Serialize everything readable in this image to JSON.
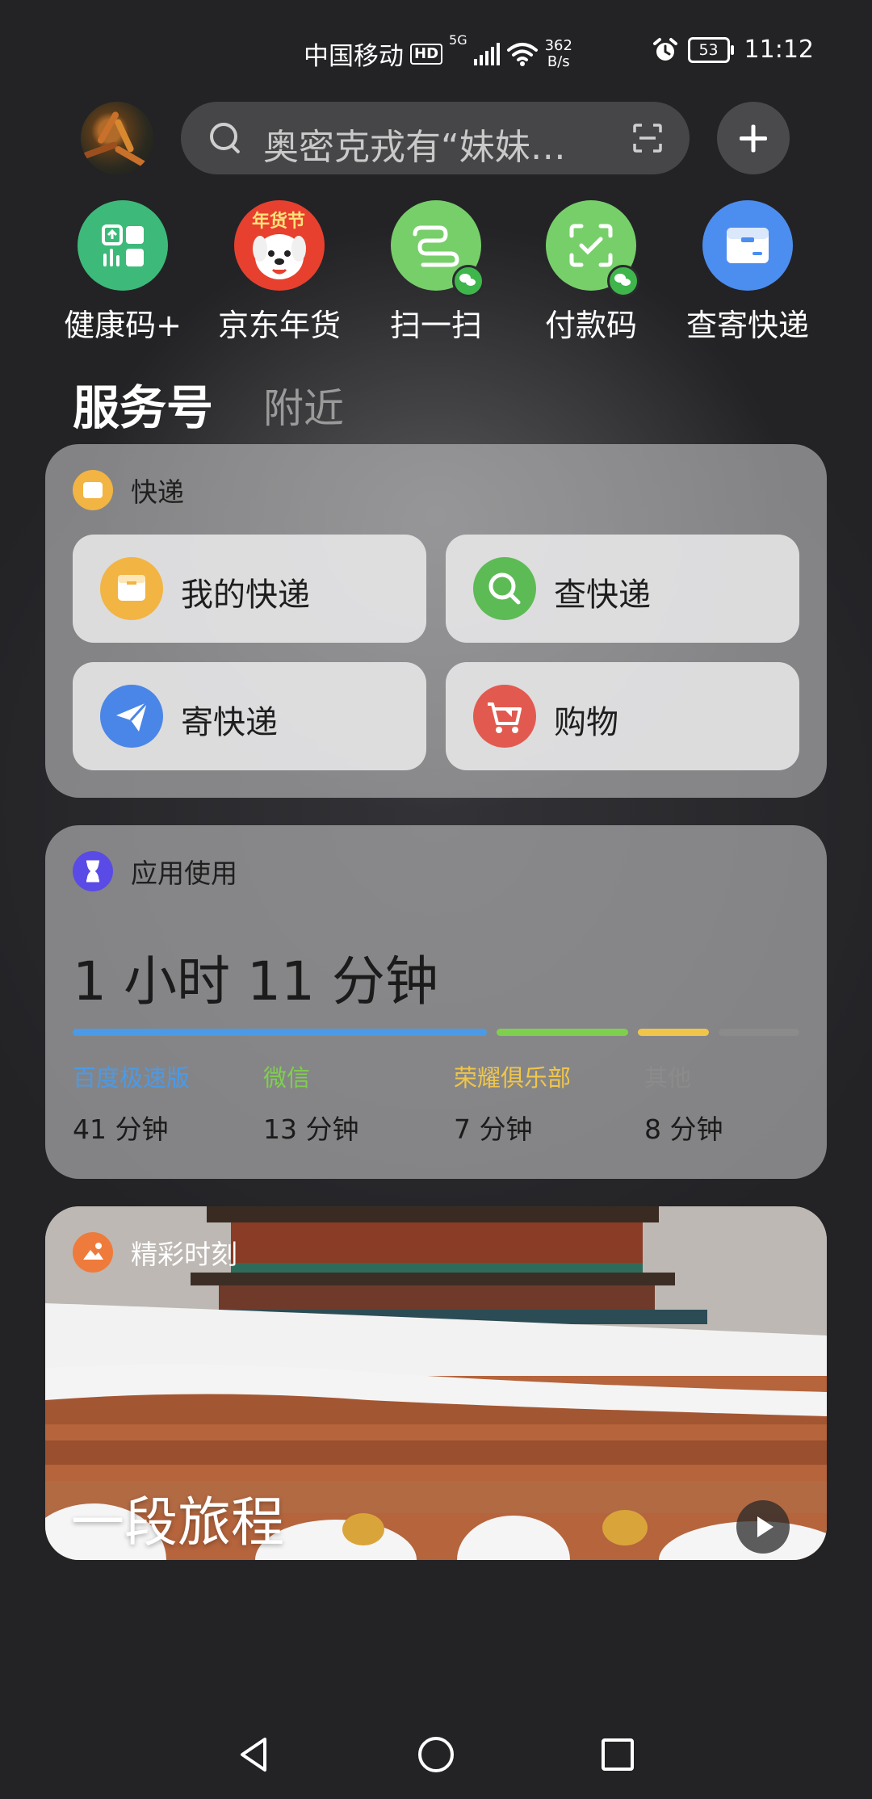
{
  "status_bar": {
    "carrier": "中国移动",
    "hd": "HD",
    "network_type": "5G",
    "speed_value": "362",
    "speed_unit": "B/s",
    "battery": "53",
    "time": "11:12"
  },
  "search": {
    "placeholder": "奥密克戎有“妹妹…"
  },
  "shortcuts": [
    {
      "label": "健康码+",
      "icon": "health-code-icon",
      "color": "#3dba7a"
    },
    {
      "label": "京东年货",
      "icon": "jd-nianhuo-icon",
      "color": "#e8402e",
      "badge_text": "年货节"
    },
    {
      "label": "扫一扫",
      "icon": "scan-icon",
      "color": "#77cf6a"
    },
    {
      "label": "付款码",
      "icon": "pay-code-icon",
      "color": "#77cf6a"
    },
    {
      "label": "查寄快递",
      "icon": "express-box-icon",
      "color": "#4b8ef0"
    }
  ],
  "tabs": {
    "active": "服务号",
    "inactive": "附近"
  },
  "express_card": {
    "title": "快递",
    "items": [
      {
        "label": "我的快递",
        "icon": "package-icon",
        "color": "#f2b443"
      },
      {
        "label": "查快递",
        "icon": "search-package-icon",
        "color": "#5dbb55"
      },
      {
        "label": "寄快递",
        "icon": "send-plane-icon",
        "color": "#4a86e8"
      },
      {
        "label": "购物",
        "icon": "cart-icon",
        "color": "#e25a4f"
      }
    ]
  },
  "usage_card": {
    "title": "应用使用",
    "total": "1 小时 11 分钟",
    "apps": [
      {
        "name": "百度极速版",
        "time": "41 分钟",
        "minutes": 41,
        "color": "#4a9ae8"
      },
      {
        "name": "微信",
        "time": "13 分钟",
        "minutes": 13,
        "color": "#7fcf4e"
      },
      {
        "name": "荣耀俱乐部",
        "time": "7 分钟",
        "minutes": 7,
        "color": "#f0c64a"
      },
      {
        "name": "其他",
        "time": "8 分钟",
        "minutes": 8,
        "color": "#8b8b8b"
      }
    ]
  },
  "moment_card": {
    "title": "精彩时刻",
    "caption": "一段旅程"
  }
}
